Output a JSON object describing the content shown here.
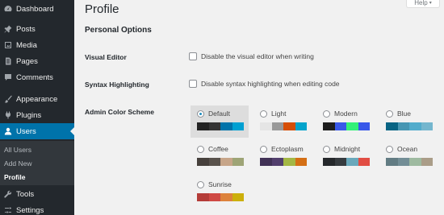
{
  "sidebar": {
    "items": [
      {
        "label": "Dashboard",
        "icon": "dashboard-icon"
      },
      {
        "label": "Posts",
        "icon": "pin-icon"
      },
      {
        "label": "Media",
        "icon": "media-icon"
      },
      {
        "label": "Pages",
        "icon": "pages-icon"
      },
      {
        "label": "Comments",
        "icon": "comment-icon"
      },
      {
        "label": "Appearance",
        "icon": "brush-icon"
      },
      {
        "label": "Plugins",
        "icon": "plug-icon"
      },
      {
        "label": "Users",
        "icon": "users-icon"
      },
      {
        "label": "Tools",
        "icon": "wrench-icon"
      },
      {
        "label": "Settings",
        "icon": "settings-icon"
      }
    ],
    "submenu": [
      "All Users",
      "Add New",
      "Profile"
    ]
  },
  "help_label": "Help",
  "page_title": "Profile",
  "section_title": "Personal Options",
  "visual_editor": {
    "label": "Visual Editor",
    "checkbox_text": "Disable the visual editor when writing"
  },
  "syntax_highlighting": {
    "label": "Syntax Highlighting",
    "checkbox_text": "Disable syntax highlighting when editing code"
  },
  "color_scheme": {
    "label": "Admin Color Scheme",
    "selected": "Default",
    "schemes": [
      {
        "name": "Default",
        "colors": [
          "#222222",
          "#333333",
          "#0073aa",
          "#00a0d2"
        ]
      },
      {
        "name": "Light",
        "colors": [
          "#e5e5e5",
          "#999999",
          "#d64e07",
          "#04a4cc"
        ]
      },
      {
        "name": "Modern",
        "colors": [
          "#1e1e1e",
          "#3858e9",
          "#33f078",
          "#3858e9"
        ]
      },
      {
        "name": "Blue",
        "colors": [
          "#096484",
          "#4796b3",
          "#52accc",
          "#74b6ce"
        ]
      },
      {
        "name": "Coffee",
        "colors": [
          "#46403c",
          "#59524c",
          "#c7a589",
          "#9ea476"
        ]
      },
      {
        "name": "Ectoplasm",
        "colors": [
          "#413256",
          "#523f6d",
          "#a3b745",
          "#d46f15"
        ]
      },
      {
        "name": "Midnight",
        "colors": [
          "#25282b",
          "#363b3f",
          "#69a8bb",
          "#e14d43"
        ]
      },
      {
        "name": "Ocean",
        "colors": [
          "#627c83",
          "#738e96",
          "#9ebaa0",
          "#aa9d88"
        ]
      },
      {
        "name": "Sunrise",
        "colors": [
          "#b43c38",
          "#cf4944",
          "#dd823b",
          "#ccaf0b"
        ]
      }
    ]
  }
}
